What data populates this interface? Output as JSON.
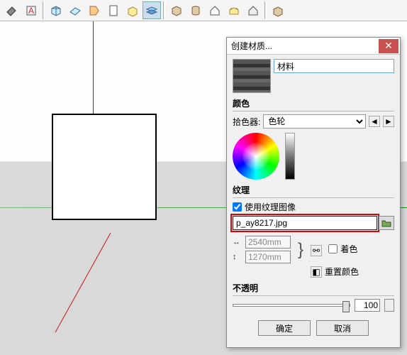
{
  "dialog": {
    "title": "创建材质...",
    "name_value": "材料",
    "section_color": "颜色",
    "picker_label": "拾色器:",
    "picker_value": "色轮",
    "section_texture": "纹理",
    "use_texture_label": "使用纹理图像",
    "file_value": "p_ay8217.jpg",
    "width_value": "2540mm",
    "height_value": "1270mm",
    "colorize_label": "着色",
    "reset_color_label": "重置颜色",
    "section_opacity": "不透明",
    "opacity_value": "100",
    "ok": "确定",
    "cancel": "取消"
  }
}
